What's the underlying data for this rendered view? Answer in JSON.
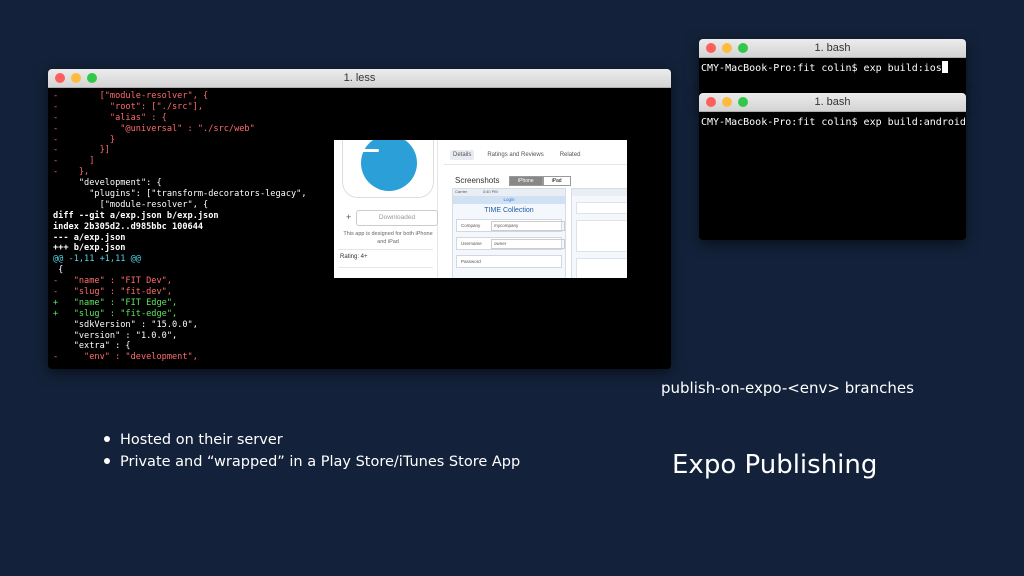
{
  "less_window": {
    "title": "1. less",
    "lines": [
      {
        "text": "-        [\"module-resolver\", {",
        "color": "red"
      },
      {
        "text": "-          \"root\": [\"./src\"],",
        "color": "red"
      },
      {
        "text": "-          \"alias\" : {",
        "color": "red"
      },
      {
        "text": "-            \"@universal\" : \"./src/web\"",
        "color": "red"
      },
      {
        "text": "-          }",
        "color": "red"
      },
      {
        "text": "-        }]",
        "color": "red"
      },
      {
        "text": "-      ]",
        "color": "red"
      },
      {
        "text": "-    },",
        "color": "red"
      },
      {
        "text": "     \"development\": {",
        "color": "white"
      },
      {
        "text": "       \"plugins\": [\"transform-decorators-legacy\",",
        "color": "white"
      },
      {
        "text": "         [\"module-resolver\", {",
        "color": "white"
      },
      {
        "text": "diff --git a/exp.json b/exp.json",
        "color": "bold"
      },
      {
        "text": "index 2b305d2..d985bbc 100644",
        "color": "bold"
      },
      {
        "text": "--- a/exp.json",
        "color": "bold"
      },
      {
        "text": "+++ b/exp.json",
        "color": "bold"
      },
      {
        "text": "@@ -1,11 +1,11 @@",
        "color": "cyan"
      },
      {
        "text": " {",
        "color": "white"
      },
      {
        "text": "-   \"name\" : \"FIT Dev\",",
        "color": "red"
      },
      {
        "text": "-   \"slug\" : \"fit-dev\",",
        "color": "red"
      },
      {
        "text": "+   \"name\" : \"FIT Edge\",",
        "color": "green"
      },
      {
        "text": "+   \"slug\" : \"fit-edge\",",
        "color": "green"
      },
      {
        "text": "    \"sdkVersion\" : \"15.0.0\",",
        "color": "white"
      },
      {
        "text": "    \"version\" : \"1.0.0\",",
        "color": "white"
      },
      {
        "text": "    \"extra\" : {",
        "color": "white"
      },
      {
        "text": "-     \"env\" : \"development\",",
        "color": "red"
      }
    ]
  },
  "bash_ios": {
    "title": "1. bash",
    "prompt": "CMY-MacBook-Pro:fit colin$ exp build:ios"
  },
  "bash_android": {
    "title": "1. bash",
    "prompt": "CMY-MacBook-Pro:fit colin$ exp build:android"
  },
  "app_store": {
    "tabs": [
      "Details",
      "Ratings and Reviews",
      "Related"
    ],
    "active_tab": "Details",
    "download_label": "Downloaded",
    "note": "This app is designed for both iPhone and iPad",
    "rating": "Rating: 4+",
    "screenshots_heading": "Screenshots",
    "device_options": [
      "iPhone",
      "iPad"
    ],
    "selected_device": "iPhone",
    "phone": {
      "carrier": "Carrier",
      "time": "3:40 PM",
      "nav_title": "Login",
      "brand": "TIME Collection",
      "fields": [
        {
          "label": "Company",
          "value": "mycompany"
        },
        {
          "label": "Username",
          "value": "owner"
        },
        {
          "label": "Password",
          "value": ""
        }
      ]
    },
    "colors": {
      "icon_blue": "#2a9fd8",
      "brand_blue": "#1d5ea8"
    }
  },
  "caption": "publish-on-expo-<env> branches",
  "heading": "Expo Publishing",
  "bullets": [
    "Hosted on their server",
    "Private and “wrapped” in a Play Store/iTunes Store App"
  ],
  "colors": {
    "background": "#13223a"
  }
}
